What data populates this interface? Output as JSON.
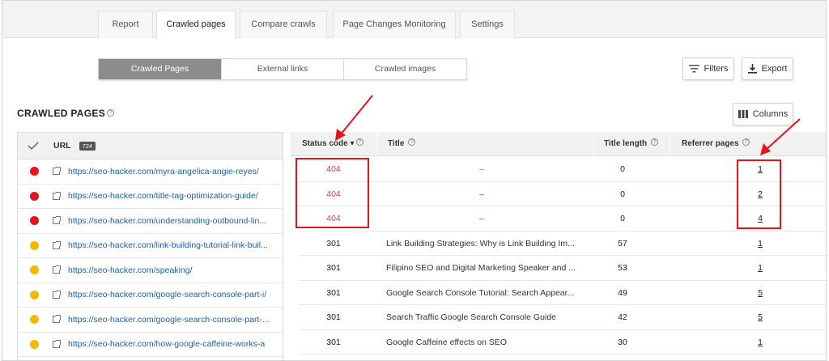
{
  "tabs": [
    "Report",
    "Crawled pages",
    "Compare crawls",
    "Page Changes Monitoring",
    "Settings"
  ],
  "subtabs": [
    "Crawled Pages",
    "External links",
    "Crawled images"
  ],
  "buttons": {
    "filters": "Filters",
    "export": "Export",
    "columns": "Columns"
  },
  "section_title": "CRAWLED PAGES",
  "left_header": {
    "url": "URL",
    "count": "724"
  },
  "urls": [
    {
      "url": "https://seo-hacker.com/myra-angelica-angie-reyes/",
      "status_color": "#e8131a"
    },
    {
      "url": "https://seo-hacker.com/title-tag-optimization-guide/",
      "status_color": "#e8131a"
    },
    {
      "url": "https://seo-hacker.com/understanding-outbound-lin...",
      "status_color": "#e8131a"
    },
    {
      "url": "https://seo-hacker.com/link-building-tutorial-link-buil...",
      "status_color": "#f5b800"
    },
    {
      "url": "https://seo-hacker.com/speaking/",
      "status_color": "#f5b800"
    },
    {
      "url": "https://seo-hacker.com/google-search-console-part-i/",
      "status_color": "#f5b800"
    },
    {
      "url": "https://seo-hacker.com/google-search-console-part-...",
      "status_color": "#f5b800"
    },
    {
      "url": "https://seo-hacker.com/how-google-caffeine-works-a",
      "status_color": "#f5b800"
    }
  ],
  "columns": {
    "status": "Status code",
    "sort": "▾",
    "title": "Title",
    "title_length": "Title length",
    "referrer": "Referrer pages"
  },
  "rows": [
    {
      "status": "404",
      "title": "–",
      "title_length": "0",
      "referrer": "1"
    },
    {
      "status": "404",
      "title": "–",
      "title_length": "0",
      "referrer": "2"
    },
    {
      "status": "404",
      "title": "–",
      "title_length": "0",
      "referrer": "4"
    },
    {
      "status": "301",
      "title": "Link Building Strategies: Why is Link Building Im...",
      "title_length": "57",
      "referrer": "1"
    },
    {
      "status": "301",
      "title": "Filipino SEO and Digital Marketing Speaker and ...",
      "title_length": "53",
      "referrer": "1"
    },
    {
      "status": "301",
      "title": "Google Search Console Tutorial: Search Appear...",
      "title_length": "49",
      "referrer": "5"
    },
    {
      "status": "301",
      "title": "Search Traffic Google Search Console Guide",
      "title_length": "42",
      "referrer": "5"
    },
    {
      "status": "301",
      "title": "Google Caffeine effects on SEO",
      "title_length": "30",
      "referrer": "1"
    }
  ],
  "colors": {
    "error": "#e53935",
    "warning": "#f5b800",
    "link": "#1a5fb4",
    "annotation": "#e8131a"
  }
}
